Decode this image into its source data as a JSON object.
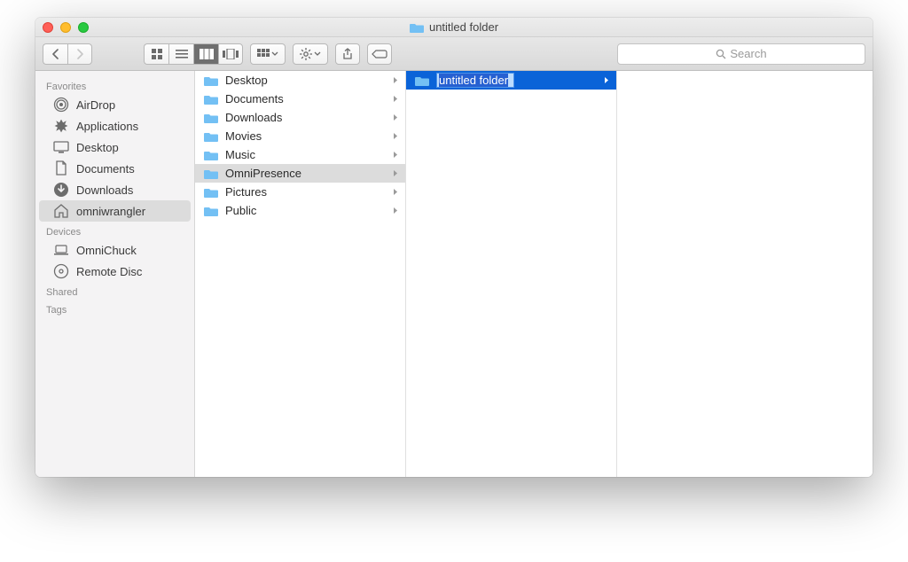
{
  "window": {
    "title": "untitled folder"
  },
  "toolbar": {
    "search_placeholder": "Search"
  },
  "sidebar": {
    "sections": [
      {
        "header": "Favorites",
        "items": [
          {
            "icon": "airdrop",
            "label": "AirDrop"
          },
          {
            "icon": "applications",
            "label": "Applications"
          },
          {
            "icon": "desktop",
            "label": "Desktop"
          },
          {
            "icon": "documents",
            "label": "Documents"
          },
          {
            "icon": "downloads",
            "label": "Downloads"
          },
          {
            "icon": "home",
            "label": "omniwrangler",
            "selected": true
          }
        ]
      },
      {
        "header": "Devices",
        "items": [
          {
            "icon": "laptop",
            "label": "OmniChuck"
          },
          {
            "icon": "disc",
            "label": "Remote Disc"
          }
        ]
      },
      {
        "header": "Shared",
        "items": []
      },
      {
        "header": "Tags",
        "items": []
      }
    ]
  },
  "columns": {
    "col1": [
      {
        "label": "Desktop",
        "has_children": true
      },
      {
        "label": "Documents",
        "has_children": true
      },
      {
        "label": "Downloads",
        "has_children": true
      },
      {
        "label": "Movies",
        "has_children": true
      },
      {
        "label": "Music",
        "has_children": true
      },
      {
        "label": "OmniPresence",
        "has_children": true,
        "selected": true
      },
      {
        "label": "Pictures",
        "has_children": true
      },
      {
        "label": "Public",
        "has_children": true
      }
    ],
    "col2": [
      {
        "label": "untitled folder",
        "has_children": true,
        "selected": true,
        "editing": true
      }
    ]
  }
}
